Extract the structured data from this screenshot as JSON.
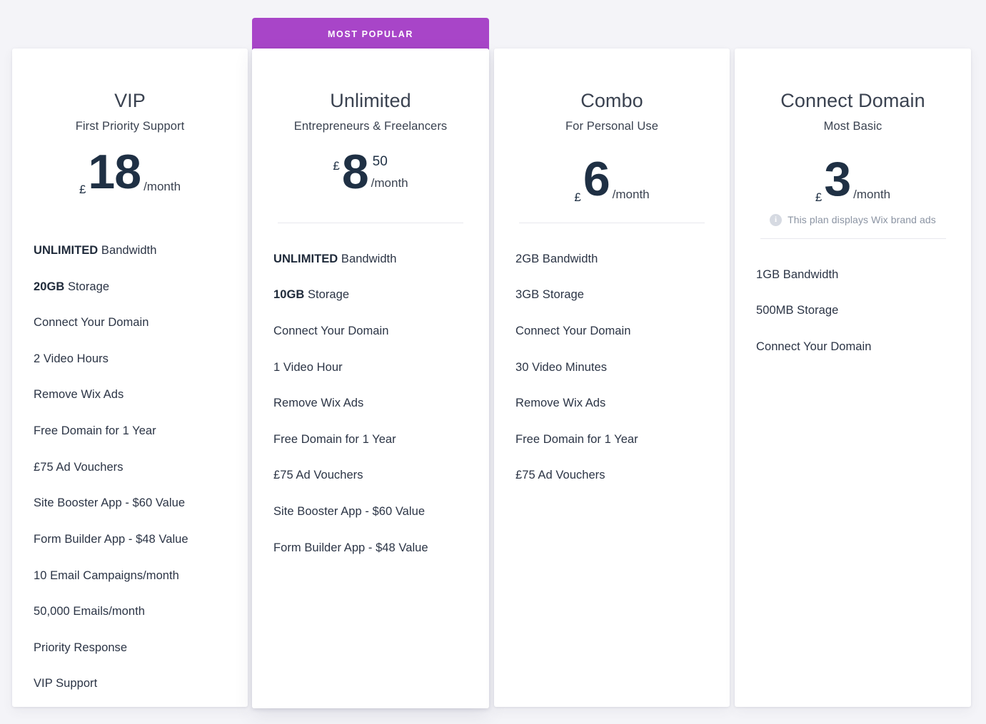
{
  "colors": {
    "page_background": "#f4f4f8",
    "card_background": "#ffffff",
    "banner_purple": "#a845c8",
    "price_text": "#1f3044",
    "feature_text": "#2b3445",
    "muted_text": "#8b94a3",
    "divider": "#e8e8ee"
  },
  "banner": {
    "label": "MOST POPULAR"
  },
  "plans": [
    {
      "name": "VIP",
      "tagline": "First Priority Support",
      "currency": "£",
      "amount": "18",
      "cents": "",
      "period": "/month",
      "note": "",
      "features": [
        {
          "bold": "UNLIMITED",
          "rest": " Bandwidth"
        },
        {
          "bold": "20GB",
          "rest": " Storage"
        },
        {
          "bold": "",
          "rest": "Connect Your Domain"
        },
        {
          "bold": "",
          "rest": "2 Video Hours"
        },
        {
          "bold": "",
          "rest": "Remove Wix Ads"
        },
        {
          "bold": "",
          "rest": "Free Domain for 1 Year"
        },
        {
          "bold": "",
          "rest": "£75 Ad Vouchers"
        },
        {
          "bold": "",
          "rest": "Site Booster App - $60 Value"
        },
        {
          "bold": "",
          "rest": "Form Builder App - $48 Value"
        },
        {
          "bold": "",
          "rest": "10 Email Campaigns/month"
        },
        {
          "bold": "",
          "rest": "50,000 Emails/month"
        },
        {
          "bold": "",
          "rest": "Priority Response"
        },
        {
          "bold": "",
          "rest": "VIP Support"
        }
      ]
    },
    {
      "name": "Unlimited",
      "tagline": "Entrepreneurs & Freelancers",
      "currency": "£",
      "amount": "8",
      "cents": "50",
      "period": "/month",
      "note": "",
      "features": [
        {
          "bold": "UNLIMITED",
          "rest": " Bandwidth"
        },
        {
          "bold": "10GB",
          "rest": " Storage"
        },
        {
          "bold": "",
          "rest": "Connect Your Domain"
        },
        {
          "bold": "",
          "rest": "1 Video Hour"
        },
        {
          "bold": "",
          "rest": "Remove Wix Ads"
        },
        {
          "bold": "",
          "rest": "Free Domain for 1 Year"
        },
        {
          "bold": "",
          "rest": "£75 Ad Vouchers"
        },
        {
          "bold": "",
          "rest": "Site Booster App - $60 Value"
        },
        {
          "bold": "",
          "rest": "Form Builder App - $48 Value"
        }
      ]
    },
    {
      "name": "Combo",
      "tagline": "For Personal Use",
      "currency": "£",
      "amount": "6",
      "cents": "",
      "period": "/month",
      "note": "",
      "features": [
        {
          "bold": "",
          "rest": "2GB Bandwidth"
        },
        {
          "bold": "",
          "rest": "3GB Storage"
        },
        {
          "bold": "",
          "rest": "Connect Your Domain"
        },
        {
          "bold": "",
          "rest": "30 Video Minutes"
        },
        {
          "bold": "",
          "rest": "Remove Wix Ads"
        },
        {
          "bold": "",
          "rest": "Free Domain for 1 Year"
        },
        {
          "bold": "",
          "rest": "£75 Ad Vouchers"
        }
      ]
    },
    {
      "name": "Connect Domain",
      "tagline": "Most Basic",
      "currency": "£",
      "amount": "3",
      "cents": "",
      "period": "/month",
      "note": "This plan displays Wix brand ads",
      "note_icon": "info-icon",
      "features": [
        {
          "bold": "",
          "rest": "1GB Bandwidth"
        },
        {
          "bold": "",
          "rest": "500MB Storage"
        },
        {
          "bold": "",
          "rest": "Connect Your Domain"
        }
      ]
    }
  ]
}
